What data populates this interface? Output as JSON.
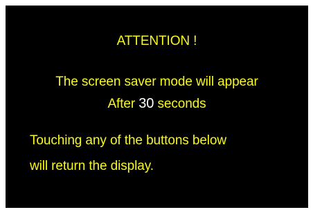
{
  "screen": {
    "background": "#000000",
    "text_color": "#f7f722",
    "countdown_color": "#ffffff"
  },
  "dialog": {
    "title": "ATTENTION !",
    "message_line1": "The screen saver mode will appear",
    "message_line2_prefix": "After",
    "countdown": "30",
    "message_line2_suffix": "seconds",
    "message_line3": "Touching any of the buttons below",
    "message_line4": "will return the display."
  }
}
